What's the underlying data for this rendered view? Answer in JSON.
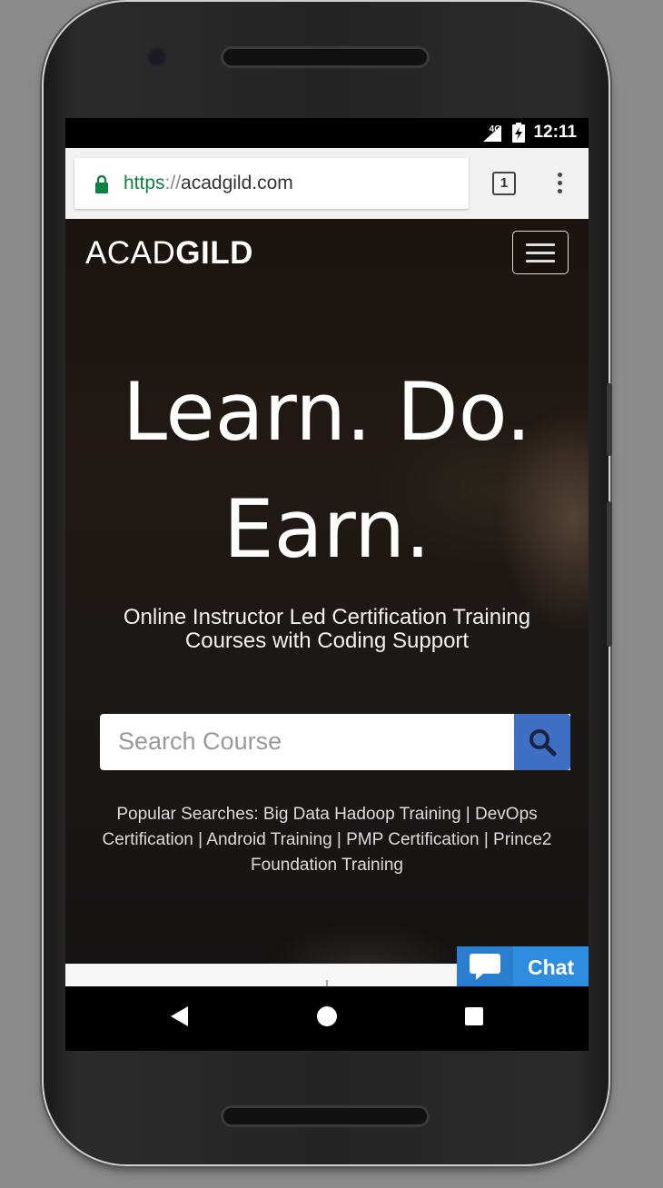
{
  "status_bar": {
    "network": "4G",
    "time": "12:11"
  },
  "browser": {
    "url_scheme": "https",
    "url_separator": "://",
    "url_host": "acadgild.com",
    "tab_count": "1"
  },
  "site": {
    "logo_light": "ACAD",
    "logo_bold": "GILD",
    "headline_line1": "Learn. Do.",
    "headline_line2": "Earn.",
    "subheadline_line1": "Online Instructor Led Certification Training",
    "subheadline_line2": "Courses with Coding Support",
    "search_placeholder": "Search Course",
    "popular_searches": "Popular Searches: Big Data Hadoop Training | DevOps Certification | Android Training | PMP Certification | Prince2 Foundation Training"
  },
  "chat": {
    "label": "Chat"
  },
  "colors": {
    "secure_green": "#0b8043",
    "search_button": "#3f6fc3",
    "chat_button": "#2f8de0"
  },
  "icons": [
    "lock-icon",
    "tabs-icon",
    "overflow-menu-icon",
    "hamburger-icon",
    "search-icon",
    "chat-bubble-icon",
    "back-icon",
    "home-icon",
    "recents-icon"
  ]
}
